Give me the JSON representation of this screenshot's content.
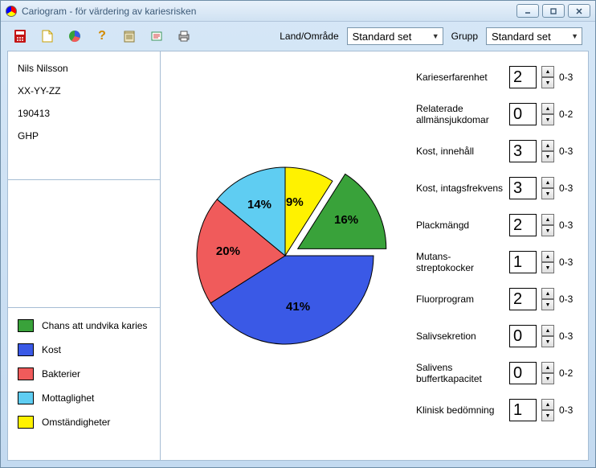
{
  "window": {
    "title": "Cariogram - för värdering av kariesrisken"
  },
  "dropdowns": {
    "land_label": "Land/Område",
    "land_value": "Standard set",
    "grupp_label": "Grupp",
    "grupp_value": "Standard set"
  },
  "patient": {
    "name": "Nils Nilsson",
    "code": "XX-YY-ZZ",
    "date": "190413",
    "group": "GHP"
  },
  "legend": {
    "items": [
      {
        "label": "Chans att undvika karies",
        "color": "#39a23a"
      },
      {
        "label": "Kost",
        "color": "#3a59e6"
      },
      {
        "label": "Bakterier",
        "color": "#f05b5b"
      },
      {
        "label": "Mottaglighet",
        "color": "#5fcdf2"
      },
      {
        "label": "Omständigheter",
        "color": "#fff200"
      }
    ]
  },
  "chart_data": {
    "type": "pie",
    "title": "",
    "series": [
      {
        "name": "Omständigheter",
        "value": 9,
        "color": "#fff200",
        "label": "9%"
      },
      {
        "name": "Chans att undvika karies",
        "value": 16,
        "color": "#39a23a",
        "label": "16%",
        "exploded": true
      },
      {
        "name": "Kost",
        "value": 41,
        "color": "#3a59e6",
        "label": "41%"
      },
      {
        "name": "Bakterier",
        "value": 20,
        "color": "#f05b5b",
        "label": "20%"
      },
      {
        "name": "Mottaglighet",
        "value": 14,
        "color": "#5fcdf2",
        "label": "14%"
      }
    ]
  },
  "params": [
    {
      "label": "Karieserfarenhet",
      "value": "2",
      "range": "0-3"
    },
    {
      "label": "Relaterade allmänsjukdomar",
      "value": "0",
      "range": "0-2"
    },
    {
      "label": "Kost, innehåll",
      "value": "3",
      "range": "0-3"
    },
    {
      "label": "Kost, intagsfrekvens",
      "value": "3",
      "range": "0-3"
    },
    {
      "label": "Plackmängd",
      "value": "2",
      "range": "0-3"
    },
    {
      "label": "Mutans-streptokocker",
      "value": "1",
      "range": "0-3"
    },
    {
      "label": "Fluorprogram",
      "value": "2",
      "range": "0-3"
    },
    {
      "label": "Salivsekretion",
      "value": "0",
      "range": "0-3"
    },
    {
      "label": "Salivens buffertkapacitet",
      "value": "0",
      "range": "0-2"
    },
    {
      "label": "Klinisk bedömning",
      "value": "1",
      "range": "0-3"
    }
  ]
}
